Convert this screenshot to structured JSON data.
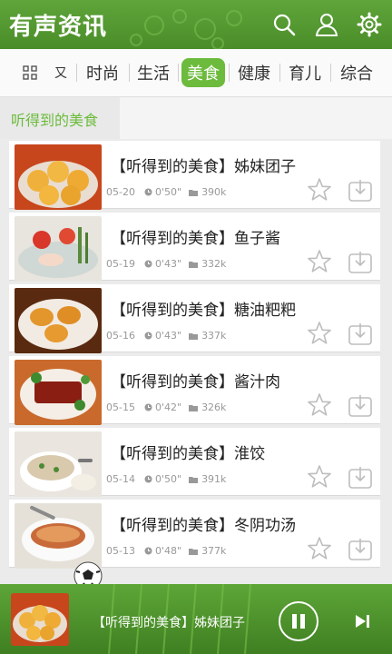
{
  "app": {
    "title": "有声资讯"
  },
  "header_icons": [
    "search-icon",
    "user-icon",
    "settings-icon"
  ],
  "tabs": [
    {
      "label": "",
      "icon": "grid-icon",
      "active": false
    },
    {
      "label": "又",
      "active": false
    },
    {
      "label": "时尚",
      "active": false
    },
    {
      "label": "生活",
      "active": false
    },
    {
      "label": "美食",
      "active": true
    },
    {
      "label": "健康",
      "active": false
    },
    {
      "label": "育儿",
      "active": false
    },
    {
      "label": "综合",
      "active": false
    }
  ],
  "section_title": "听得到的美食",
  "items": [
    {
      "title": "【听得到的美食】姊妹团子",
      "date": "05-20",
      "duration": "0'50\"",
      "size": "390k"
    },
    {
      "title": "【听得到的美食】鱼子酱",
      "date": "05-19",
      "duration": "0'43\"",
      "size": "332k"
    },
    {
      "title": "【听得到的美食】糖油粑粑",
      "date": "05-16",
      "duration": "0'43\"",
      "size": "337k"
    },
    {
      "title": "【听得到的美食】酱汁肉",
      "date": "05-15",
      "duration": "0'42\"",
      "size": "326k"
    },
    {
      "title": "【听得到的美食】淮饺",
      "date": "05-14",
      "duration": "0'50\"",
      "size": "391k"
    },
    {
      "title": "【听得到的美食】冬阴功汤",
      "date": "05-13",
      "duration": "0'48\"",
      "size": "377k"
    }
  ],
  "player": {
    "title": "【听得到的美食】姊妹团子"
  },
  "colors": {
    "brand_green": "#5fa53a",
    "active_tab": "#6cbb3c",
    "section_text": "#6cbb3c"
  }
}
